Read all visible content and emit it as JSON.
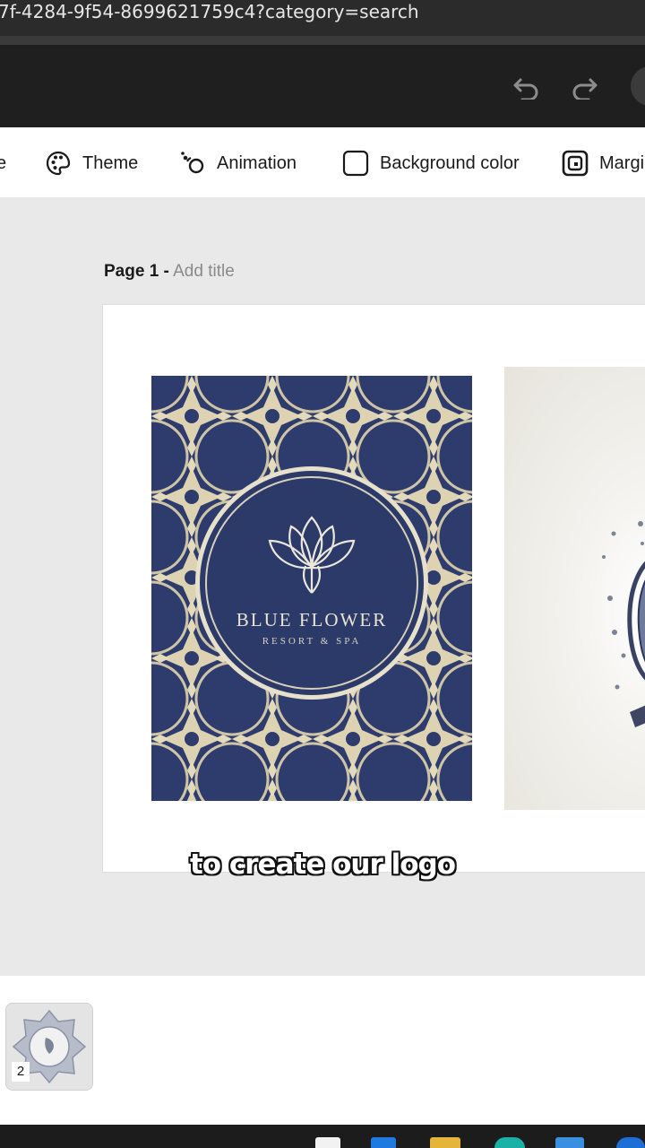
{
  "browser": {
    "url": "7f-4284-9f54-8699621759c4?category=search"
  },
  "header": {
    "undo_label": "undo",
    "redo_label": "redo"
  },
  "toolbar": {
    "items": [
      {
        "label": "Theme",
        "icon": "palette-icon"
      },
      {
        "label": "Animation",
        "icon": "animation-icon"
      },
      {
        "label": "Background color",
        "icon": "background-color-icon"
      },
      {
        "label": "Margi",
        "icon": "margins-icon"
      }
    ],
    "partial_left": "e"
  },
  "page": {
    "label": "Page 1 -",
    "title_placeholder": "Add title"
  },
  "logo": {
    "name": "BLUE FLOWER",
    "tagline": "RESORT & SPA"
  },
  "caption": "to create our logo",
  "pages_panel": {
    "thumb_number": "2"
  },
  "colors": {
    "logo_navy": "#2b3a6b",
    "ornament_gold": "#d9cba7",
    "header_dark": "#1f1f1f"
  }
}
